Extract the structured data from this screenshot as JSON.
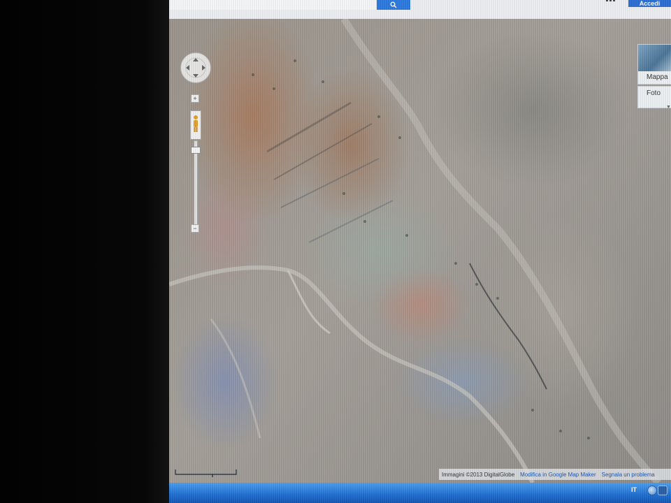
{
  "topbar": {
    "search_placeholder": "",
    "search_icon": "magnifier-icon",
    "signin_label": "Accedi"
  },
  "map_controls": {
    "pan_icon": "pan-arrows-icon",
    "zoom_in_label": "+",
    "zoom_out_label": "−",
    "pegman_icon": "street-view-pegman-icon",
    "zoom_level_fraction": 0.08
  },
  "map_types": {
    "map_label": "Mappa",
    "photo_label": "Foto"
  },
  "attribution": {
    "imagery": "Immagini ©2013 DigitalGlobe",
    "edit_link": "Modifica in Google Map Maker",
    "report_link": "Segnala un problema"
  },
  "taskbar": {
    "language": "IT",
    "tray_icons": [
      "network-icon",
      "app-icon"
    ]
  },
  "colors": {
    "search_button": "#2b7ae0",
    "taskbar": "#1e6fd3"
  }
}
